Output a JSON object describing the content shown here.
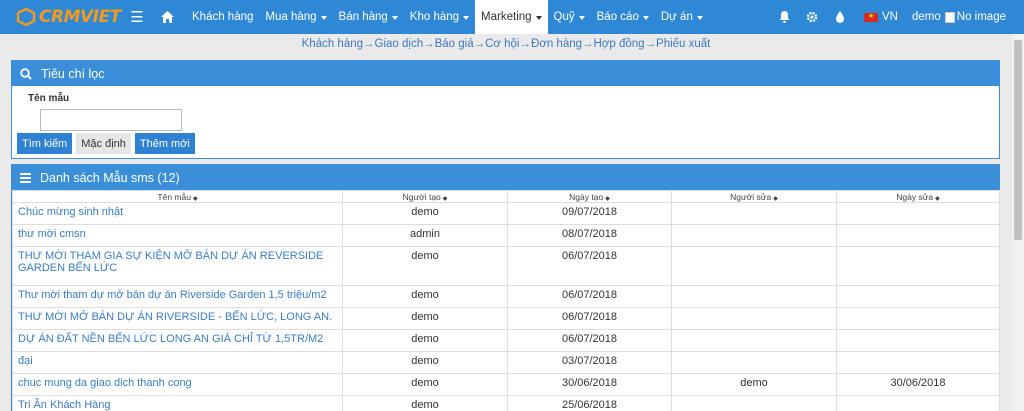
{
  "nav": {
    "logo": "CRMVIET",
    "menu": [
      {
        "label": "Khách hàng",
        "caret": false
      },
      {
        "label": "Mua hàng",
        "caret": true
      },
      {
        "label": "Bán hàng",
        "caret": true
      },
      {
        "label": "Kho hàng",
        "caret": true
      },
      {
        "label": "Marketing",
        "caret": true,
        "active": true
      },
      {
        "label": "Quỹ",
        "caret": true
      },
      {
        "label": "Báo cáo",
        "caret": true
      },
      {
        "label": "Dự án",
        "caret": true
      }
    ],
    "lang": "VN",
    "user": "demo",
    "avatar_alt": "No image"
  },
  "breadcrumb": "Khách hàng→Giao dịch→Báo giá→Cơ hội→Đơn hàng→Hợp đồng→Phiếu xuất",
  "filter": {
    "title": "Tiêu chí lọc",
    "field_label": "Tên mẫu",
    "field_value": "",
    "search_btn": "Tìm kiếm",
    "default_btn": "Mặc định",
    "add_btn": "Thêm mới"
  },
  "list": {
    "title": "Danh sách Mẫu sms (12)",
    "columns": [
      "Tên mẫu",
      "Người tạo",
      "Ngày tạo",
      "Người sửa",
      "Ngày sửa"
    ],
    "rows": [
      [
        "Chúc mừng sinh nhật",
        "demo",
        "09/07/2018",
        "",
        ""
      ],
      [
        "thư mời cmsn",
        "admin",
        "08/07/2018",
        "",
        ""
      ],
      [
        "THƯ MỜI THAM GIA SỰ KIỆN MỞ BÁN DỰ ÁN REVERSIDE GARDEN BẾN LỨC",
        "demo",
        "06/07/2018",
        "",
        ""
      ],
      [
        "Thư mời tham dự mở bán dự án Riverside Garden 1,5 triệu/m2",
        "demo",
        "06/07/2018",
        "",
        ""
      ],
      [
        "THƯ MỜI MỞ BÁN DỰ ÁN RIVERSIDE - BẾN LỨC, LONG AN.",
        "demo",
        "06/07/2018",
        "",
        ""
      ],
      [
        "DỰ ÁN ĐẤT NỀN BẾN LỨC LONG AN GIÁ CHỈ TỪ 1,5TR/M2",
        "demo",
        "06/07/2018",
        "",
        ""
      ],
      [
        "đại",
        "demo",
        "03/07/2018",
        "",
        ""
      ],
      [
        "chuc mung da giao dich thanh cong",
        "demo",
        "30/06/2018",
        "demo",
        "30/06/2018"
      ],
      [
        "Tri Ân Khách Hàng",
        "demo",
        "25/06/2018",
        "",
        ""
      ]
    ]
  }
}
